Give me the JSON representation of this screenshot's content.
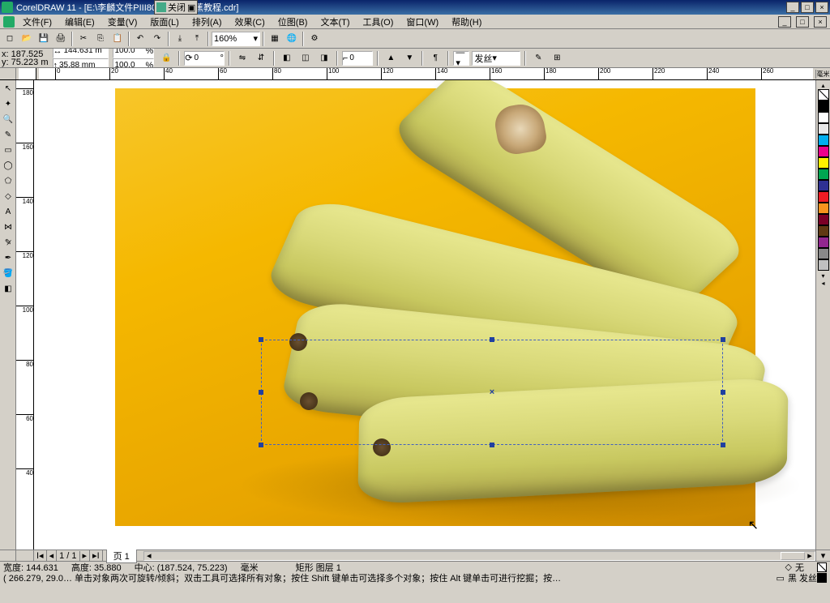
{
  "title": "CorelDRAW 11 - [E:\\李麟文件PIII800\\CDR\\香蕉教程.cdr]",
  "menus": [
    "文件(F)",
    "编辑(E)",
    "变量(V)",
    "版面(L)",
    "排列(A)",
    "效果(C)",
    "位图(B)",
    "文本(T)",
    "工具(O)",
    "窗口(W)",
    "帮助(H)"
  ],
  "zoom": "160%",
  "pos": {
    "xlabel": "x:",
    "ylabel": "y:",
    "x": "187.525",
    "y": "75.223 m"
  },
  "size": {
    "w": "144.631 m",
    "h": "35.88 mm"
  },
  "scale": {
    "x": "100.0",
    "y": "100.0"
  },
  "rotation": "0",
  "corner": "0",
  "hairline": "发丝",
  "ruler_h": [
    0,
    20,
    40,
    60,
    80,
    100,
    120,
    140,
    160,
    180,
    200,
    220,
    240,
    260
  ],
  "ruler_h_end": "毫米",
  "ruler_v": [
    180,
    160,
    140,
    120,
    100,
    80,
    60,
    40
  ],
  "pagenav": {
    "pages": "1 / 1",
    "tab": "页 1"
  },
  "status1": {
    "width": "宽度: 144.631",
    "height": "高度: 35.880",
    "center": "中心: (187.524, 75.223)",
    "unit": "毫米",
    "shape": "矩形 图层 1",
    "fill": "无",
    "outline": "黑 发丝"
  },
  "status2": "( 266.279, 29.0…  单击对象两次可旋转/倾斜；双击工具可选择所有对象；按住 Shift 键单击可选择多个对象；按住 Alt 键单击可进行挖掘；按…",
  "floatbar_label": "关闭",
  "palette": [
    "#000000",
    "#ffffff",
    "#e8e8e8",
    "#00aeef",
    "#ec008c",
    "#fff200",
    "#00a651",
    "#2e3192",
    "#ed1c24",
    "#f7941d",
    "#7a0026",
    "#603913",
    "#92278f",
    "#898989",
    "#c0c0c0"
  ],
  "windown_btns": [
    "_",
    "□",
    "×"
  ],
  "fill_icon": "◇",
  "outline_icon": "▭"
}
